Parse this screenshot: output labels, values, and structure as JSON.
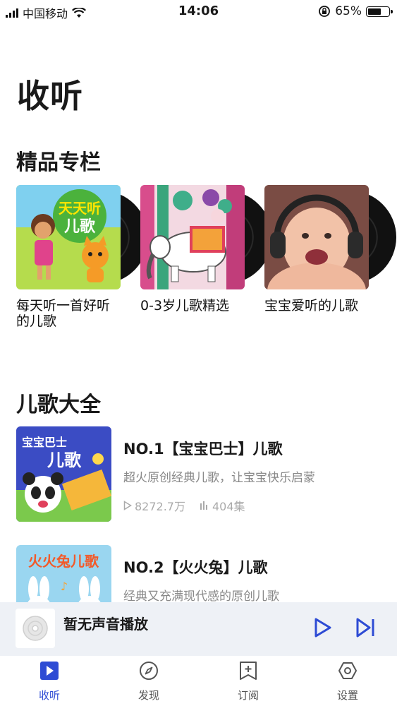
{
  "status_bar": {
    "carrier": "中国移动",
    "time": "14:06",
    "battery": "65%",
    "battery_level": 0.65
  },
  "page_title": "收听",
  "featured": {
    "title": "精品专栏",
    "albums": [
      {
        "title": "每天听一首好听的儿歌",
        "cover_text": "天天听 儿歌"
      },
      {
        "title": "0-3岁儿歌精选"
      },
      {
        "title": "宝宝爱听的儿歌"
      }
    ]
  },
  "collection": {
    "title": "儿歌大全",
    "items": [
      {
        "title": "NO.1【宝宝巴士】儿歌",
        "desc": "超火原创经典儿歌，让宝宝快乐启蒙",
        "plays": "8272.7万",
        "episodes": "404集",
        "cover_text": "宝宝巴士 儿歌"
      },
      {
        "title": "NO.2【火火兔】儿歌",
        "desc": "经典又充满现代感的原创儿歌",
        "cover_text": "火火兔儿歌"
      }
    ]
  },
  "player": {
    "title": "暂无声音播放"
  },
  "tabs": [
    {
      "label": "收听"
    },
    {
      "label": "发现"
    },
    {
      "label": "订阅"
    },
    {
      "label": "设置"
    }
  ],
  "colors": {
    "accent": "#2d4bd4",
    "player_bg": "#eef1f6"
  }
}
